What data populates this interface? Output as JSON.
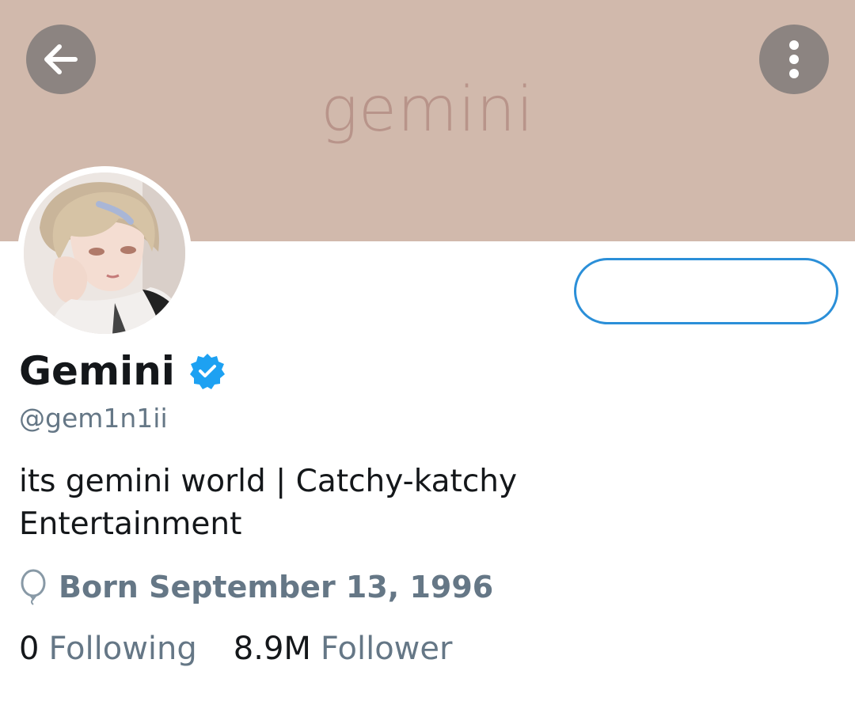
{
  "header": {
    "banner_text": "gemini",
    "banner_color": "#d1b9ac",
    "back_icon": "arrow-left-icon",
    "menu_icon": "more-vertical-icon"
  },
  "profile": {
    "avatar": "profile-avatar-image",
    "display_name": "Gemini",
    "verified": true,
    "verified_icon": "verified-badge-icon",
    "handle": "@gem1n1ii",
    "bio_line1": "its gemini world | Catchy-katchy",
    "bio_line2": "Entertainment",
    "birth_icon": "balloon-icon",
    "born": "Born September 13, 1996"
  },
  "follow_button": {
    "label": "",
    "border_color": "#2b8fd8"
  },
  "stats": {
    "following_count": "0",
    "following_label": "Following",
    "followers_count": "8.9M",
    "followers_label": "Follower"
  },
  "colors": {
    "accent": "#1da1f2",
    "secondary_text": "#657786",
    "primary_text": "#14171a"
  }
}
